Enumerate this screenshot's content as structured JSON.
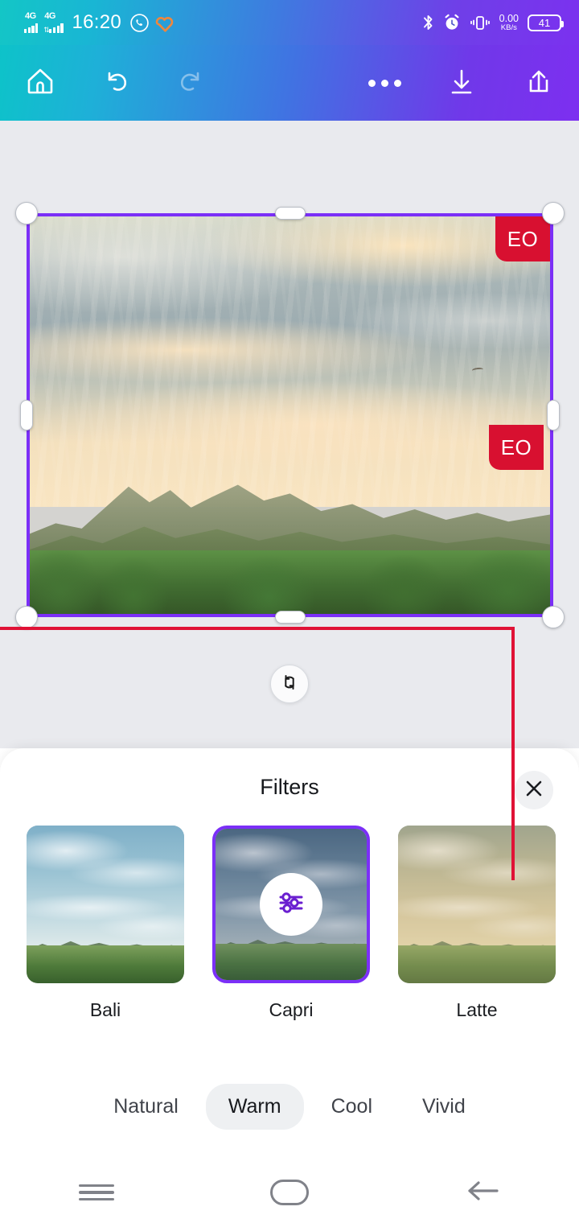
{
  "status_bar": {
    "network_1": "4G",
    "network_2": "4G",
    "time": "16:20",
    "whatsapp_icon": "whatsapp-icon",
    "health_icon": "health-heart-icon",
    "bluetooth_icon": "bluetooth-icon",
    "alarm_icon": "alarm-clock-icon",
    "vibrate_icon": "vibrate-icon",
    "data_rate_value": "0.00",
    "data_rate_unit": "KB/s",
    "battery_level": "41"
  },
  "toolbar": {
    "home_label": "home-icon",
    "undo_label": "undo-icon",
    "redo_label": "redo-icon",
    "more_label": "more-options-icon",
    "download_label": "download-icon",
    "share_label": "share-icon"
  },
  "canvas": {
    "badge_top_right": "EO",
    "badge_middle": "EO",
    "rotate_label": "rotate-icon"
  },
  "sheet": {
    "title": "Filters",
    "close_label": "✕",
    "filters": [
      {
        "name": "Bali",
        "selected": false
      },
      {
        "name": "Capri",
        "selected": true
      },
      {
        "name": "Latte",
        "selected": false
      }
    ],
    "selected_filter_icon": "sliders-adjust-icon",
    "categories": [
      {
        "label": "Natural",
        "active": false
      },
      {
        "label": "Warm",
        "active": true
      },
      {
        "label": "Cool",
        "active": false
      },
      {
        "label": "Vivid",
        "active": false
      }
    ]
  },
  "nav_bar": {
    "recents_label": "recent-apps-icon",
    "home_label": "home-nav-icon",
    "back_label": "back-arrow-icon"
  },
  "colors": {
    "accent_purple": "#7b2ff7",
    "badge_red": "#d81030",
    "guide_red": "#e01236",
    "gradient_start": "#0dc3c9",
    "gradient_end": "#7d2ff0",
    "canvas_bg": "#e9eaee"
  }
}
